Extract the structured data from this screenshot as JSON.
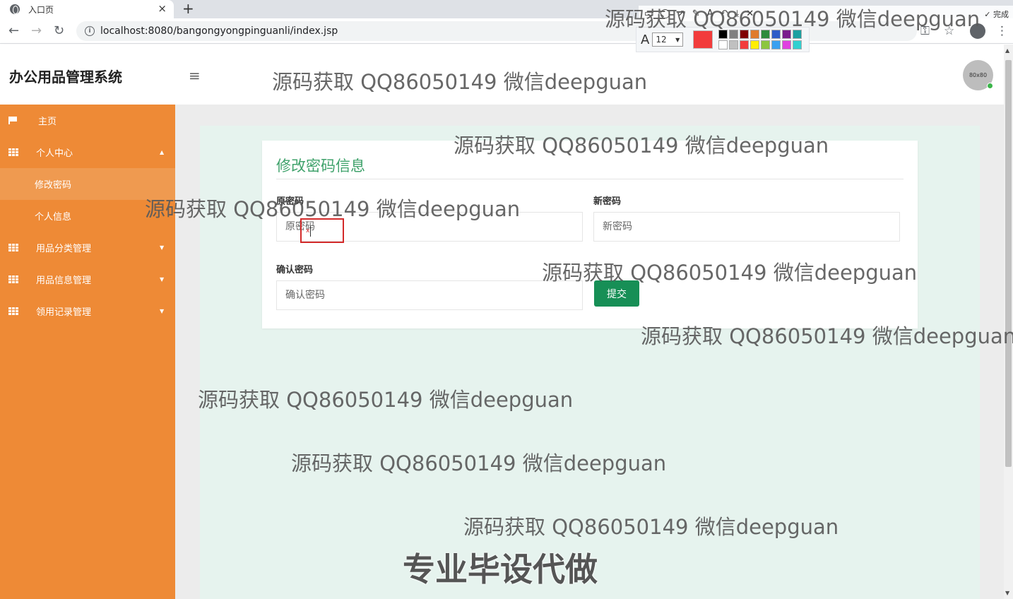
{
  "browser": {
    "tab_title": "入口页",
    "tab_close": "×",
    "new_tab": "+",
    "url": "localhost:8080/bangongyongpinguanli/index.jsp",
    "back": "←",
    "forward": "→",
    "reload": "↻",
    "key_icon": "⚿",
    "star_icon": "☆",
    "menu_icon": "⋮"
  },
  "screenshot_tool": {
    "done_label": "完成",
    "font_glyph": "A",
    "font_size": "12",
    "current_color": "#f23c3c",
    "palette": [
      "#000000",
      "#808080",
      "#800000",
      "#e07b2b",
      "#2e8b3c",
      "#2e5cc8",
      "#7a1b8c",
      "#1aa0a0",
      "#ffffff",
      "#c0c0c0",
      "#f23c3c",
      "#ffee00",
      "#8cc63f",
      "#3aa0f0",
      "#e040e0",
      "#30d0d0"
    ]
  },
  "header": {
    "app_title": "办公用品管理系统",
    "menu_icon": "≡",
    "avatar_text": "80x80"
  },
  "sidebar": {
    "items": [
      {
        "label": "主页"
      },
      {
        "label": "个人中心",
        "caret": "▲"
      },
      {
        "label": "修改密码"
      },
      {
        "label": "个人信息"
      },
      {
        "label": "用品分类管理",
        "caret": "▼"
      },
      {
        "label": "用品信息管理",
        "caret": "▼"
      },
      {
        "label": "领用记录管理",
        "caret": "▼"
      }
    ]
  },
  "form": {
    "title": "修改密码信息",
    "old_password_label": "原密码",
    "old_password_placeholder": "原密码",
    "new_password_label": "新密码",
    "new_password_placeholder": "新密码",
    "confirm_password_label": "确认密码",
    "confirm_password_placeholder": "确认密码",
    "submit_label": "提交"
  },
  "watermarks": {
    "line": "源码获取 QQ86050149 微信deepguan",
    "big": "专业毕设代做"
  }
}
